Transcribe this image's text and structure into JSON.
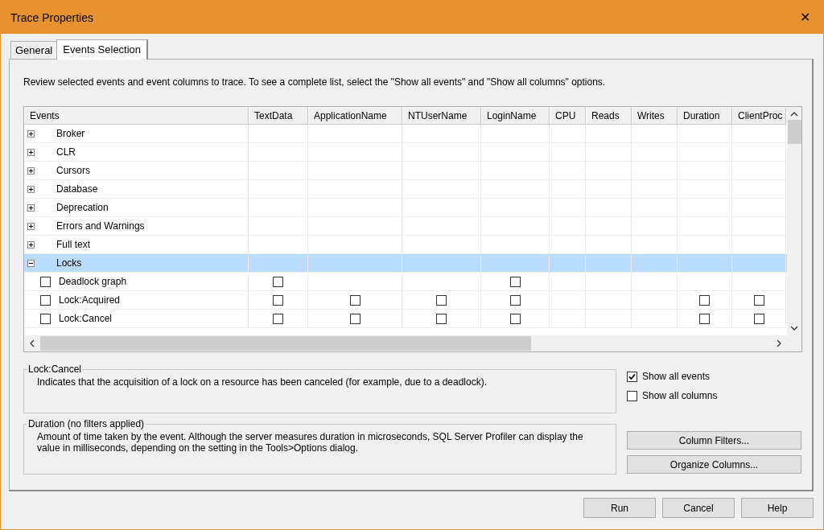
{
  "window": {
    "title": "Trace Properties",
    "close": "✕"
  },
  "tabs": [
    {
      "label": "General",
      "selected": false
    },
    {
      "label": "Events Selection",
      "selected": true
    }
  ],
  "instructions": "Review selected events and event columns to trace. To see a complete list, select the \"Show all events\" and \"Show all columns\" options.",
  "grid": {
    "columns": [
      "Events",
      "TextData",
      "ApplicationName",
      "NTUserName",
      "LoginName",
      "CPU",
      "Reads",
      "Writes",
      "Duration",
      "ClientProc"
    ],
    "rows": [
      {
        "name": "Broker",
        "expanded": false,
        "selected": false,
        "children": []
      },
      {
        "name": "CLR",
        "expanded": false,
        "selected": false,
        "children": []
      },
      {
        "name": "Cursors",
        "expanded": false,
        "selected": false,
        "children": []
      },
      {
        "name": "Database",
        "expanded": false,
        "selected": false,
        "children": []
      },
      {
        "name": "Deprecation",
        "expanded": false,
        "selected": false,
        "children": []
      },
      {
        "name": "Errors and Warnings",
        "expanded": false,
        "selected": false,
        "children": []
      },
      {
        "name": "Full text",
        "expanded": false,
        "selected": false,
        "children": []
      },
      {
        "name": "Locks",
        "expanded": true,
        "selected": true,
        "children": [
          {
            "name": "Deadlock graph",
            "checked": false,
            "cells": [
              {
                "checked": false
              },
              null,
              null,
              {
                "checked": false
              },
              null,
              null,
              null,
              null,
              null
            ]
          },
          {
            "name": "Lock:Acquired",
            "checked": false,
            "cells": [
              {
                "checked": false
              },
              {
                "checked": false
              },
              {
                "checked": false
              },
              {
                "checked": false
              },
              null,
              null,
              null,
              {
                "checked": false
              },
              {
                "checked": false
              }
            ]
          },
          {
            "name": "Lock:Cancel",
            "checked": false,
            "cells": [
              {
                "checked": false
              },
              {
                "checked": false
              },
              {
                "checked": false
              },
              {
                "checked": false
              },
              null,
              null,
              null,
              {
                "checked": false
              },
              {
                "checked": false
              }
            ]
          }
        ]
      }
    ]
  },
  "event_info": {
    "title": "Lock:Cancel",
    "text": "Indicates that the acquisition of a lock on a resource has been canceled (for example, due to a deadlock)."
  },
  "column_info": {
    "title": "Duration (no filters applied)",
    "text": "Amount of time taken by the event. Although the server measures duration in microseconds, SQL Server Profiler can display the value in milliseconds, depending on the setting in the Tools>Options dialog."
  },
  "options": [
    {
      "label": "Show all events",
      "checked": true
    },
    {
      "label": "Show all columns",
      "checked": false
    }
  ],
  "side_buttons": [
    "Column Filters...",
    "Organize Columns..."
  ],
  "footer_buttons": [
    "Run",
    "Cancel",
    "Help"
  ]
}
